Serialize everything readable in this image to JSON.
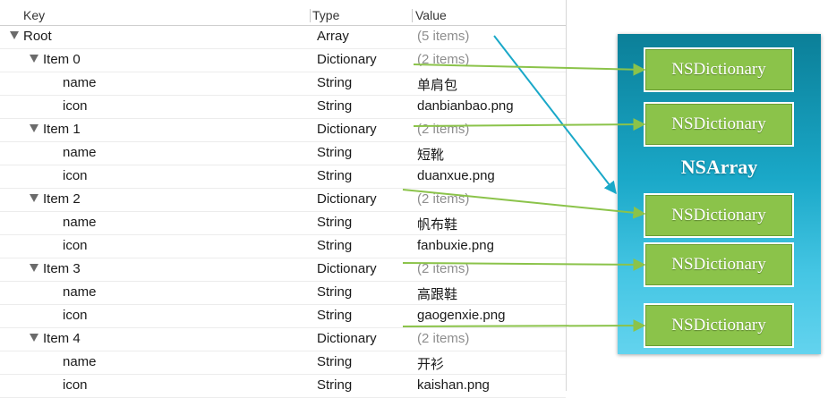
{
  "table": {
    "headers": {
      "key": "Key",
      "type": "Type",
      "value": "Value"
    },
    "rows": [
      {
        "key": "Root",
        "type": "Array",
        "value": "(5 items)",
        "level": 0,
        "expandable": true,
        "muted": true
      },
      {
        "key": "Item 0",
        "type": "Dictionary",
        "value": "(2 items)",
        "level": 1,
        "expandable": true,
        "muted": true
      },
      {
        "key": "name",
        "type": "String",
        "value": "单肩包",
        "level": 2,
        "expandable": false,
        "muted": false
      },
      {
        "key": "icon",
        "type": "String",
        "value": "danbianbao.png",
        "level": 2,
        "expandable": false,
        "muted": false
      },
      {
        "key": "Item 1",
        "type": "Dictionary",
        "value": "(2 items)",
        "level": 1,
        "expandable": true,
        "muted": true
      },
      {
        "key": "name",
        "type": "String",
        "value": "短靴",
        "level": 2,
        "expandable": false,
        "muted": false
      },
      {
        "key": "icon",
        "type": "String",
        "value": "duanxue.png",
        "level": 2,
        "expandable": false,
        "muted": false
      },
      {
        "key": "Item 2",
        "type": "Dictionary",
        "value": "(2 items)",
        "level": 1,
        "expandable": true,
        "muted": true
      },
      {
        "key": "name",
        "type": "String",
        "value": "帆布鞋",
        "level": 2,
        "expandable": false,
        "muted": false
      },
      {
        "key": "icon",
        "type": "String",
        "value": "fanbuxie.png",
        "level": 2,
        "expandable": false,
        "muted": false
      },
      {
        "key": "Item 3",
        "type": "Dictionary",
        "value": "(2 items)",
        "level": 1,
        "expandable": true,
        "muted": true
      },
      {
        "key": "name",
        "type": "String",
        "value": "高跟鞋",
        "level": 2,
        "expandable": false,
        "muted": false
      },
      {
        "key": "icon",
        "type": "String",
        "value": "gaogenxie.png",
        "level": 2,
        "expandable": false,
        "muted": false
      },
      {
        "key": "Item 4",
        "type": "Dictionary",
        "value": "(2 items)",
        "level": 1,
        "expandable": true,
        "muted": true
      },
      {
        "key": "name",
        "type": "String",
        "value": "开衫",
        "level": 2,
        "expandable": false,
        "muted": false
      },
      {
        "key": "icon",
        "type": "String",
        "value": "kaishan.png",
        "level": 2,
        "expandable": false,
        "muted": false
      }
    ]
  },
  "diagram": {
    "array_label": "NSArray",
    "dict_labels": [
      "NSDictionary",
      "NSDictionary",
      "NSDictionary",
      "NSDictionary",
      "NSDictionary"
    ]
  },
  "colors": {
    "panel_top": "#0b7f98",
    "panel_bottom": "#63d3ee",
    "dict_fill": "#8bc34a",
    "green_arrow": "#8bc34a",
    "blue_arrow": "#1aa8c8",
    "muted_text": "#8e8e8e"
  },
  "icons": {
    "disclosure": "disclosure-triangle-icon"
  }
}
